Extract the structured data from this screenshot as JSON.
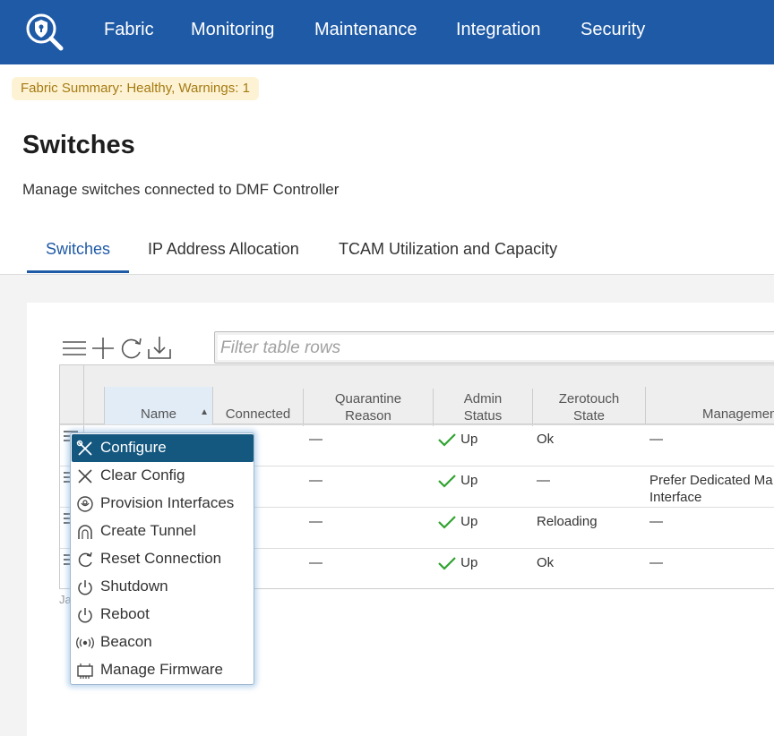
{
  "nav": {
    "items": [
      "Fabric",
      "Monitoring",
      "Maintenance",
      "Integration",
      "Security"
    ]
  },
  "summary": "Fabric Summary: Healthy, Warnings: 1",
  "page": {
    "title": "Switches",
    "subtitle": "Manage switches connected to DMF Controller"
  },
  "tabs": [
    "Switches",
    "IP Address Allocation",
    "TCAM Utilization and Capacity"
  ],
  "toolbar": {
    "filter_placeholder": "Filter table rows"
  },
  "table": {
    "headers": {
      "name": "Name",
      "connected": "Connected",
      "quarantine_1": "Quarantine",
      "quarantine_2": "Reason",
      "admin_1": "Admin",
      "admin_2": "Status",
      "zero_1": "Zerotouch",
      "zero_2": "State",
      "management": "Management"
    },
    "rows": [
      {
        "quarantine": "—",
        "admin": "Up",
        "zerotouch": "Ok",
        "management_1": "—",
        "management_2": ""
      },
      {
        "quarantine": "—",
        "admin": "Up",
        "zerotouch": "—",
        "management_1": "Prefer Dedicated Ma",
        "management_2": "Interface"
      },
      {
        "quarantine": "—",
        "admin": "Up",
        "zerotouch": "Reloading",
        "management_1": "—",
        "management_2": ""
      },
      {
        "quarantine": "—",
        "admin": "Up",
        "zerotouch": "Ok",
        "management_1": "—",
        "management_2": ""
      }
    ],
    "footer_fragment": "Ja"
  },
  "context_menu": {
    "items": [
      {
        "label": "Configure",
        "icon": "wrench-screwdriver-icon"
      },
      {
        "label": "Clear Config",
        "icon": "x-icon"
      },
      {
        "label": "Provision Interfaces",
        "icon": "provision-icon"
      },
      {
        "label": "Create Tunnel",
        "icon": "tunnel-icon"
      },
      {
        "label": "Reset Connection",
        "icon": "reset-icon"
      },
      {
        "label": "Shutdown",
        "icon": "power-icon"
      },
      {
        "label": "Reboot",
        "icon": "reboot-icon"
      },
      {
        "label": "Beacon",
        "icon": "beacon-icon"
      },
      {
        "label": "Manage Firmware",
        "icon": "chip-icon"
      }
    ]
  },
  "colors": {
    "brand_blue": "#1f5aa6",
    "menu_active": "#14577f",
    "badge_bg": "#fdf3d4",
    "badge_text": "#a57a12",
    "check_green": "#2ea32e"
  }
}
